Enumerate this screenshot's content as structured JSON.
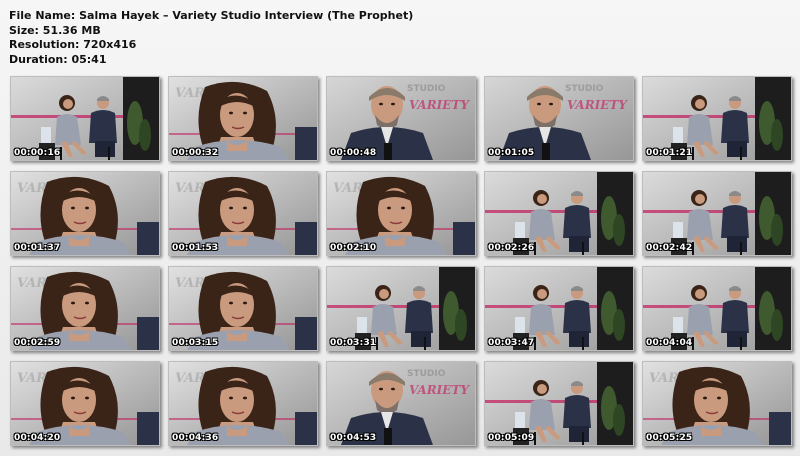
{
  "info": {
    "file_name": "File Name: Salma Hayek – Variety Studio Interview (The Prophet)",
    "size": "Size:  51.36 MB",
    "resolution": "Resolution: 720x416",
    "duration": "Duration:  05:41"
  },
  "thumbnails": [
    {
      "time": "00:00:16",
      "scene": "wide"
    },
    {
      "time": "00:00:32",
      "scene": "woman"
    },
    {
      "time": "00:00:48",
      "scene": "man"
    },
    {
      "time": "00:01:05",
      "scene": "man"
    },
    {
      "time": "00:01:21",
      "scene": "wide"
    },
    {
      "time": "00:01:37",
      "scene": "woman"
    },
    {
      "time": "00:01:53",
      "scene": "woman"
    },
    {
      "time": "00:02:10",
      "scene": "woman"
    },
    {
      "time": "00:02:26",
      "scene": "wide"
    },
    {
      "time": "00:02:42",
      "scene": "wide"
    },
    {
      "time": "00:02:59",
      "scene": "woman"
    },
    {
      "time": "00:03:15",
      "scene": "woman"
    },
    {
      "time": "00:03:31",
      "scene": "wide"
    },
    {
      "time": "00:03:47",
      "scene": "wide"
    },
    {
      "time": "00:04:04",
      "scene": "wide"
    },
    {
      "time": "00:04:20",
      "scene": "woman"
    },
    {
      "time": "00:04:36",
      "scene": "woman"
    },
    {
      "time": "00:04:53",
      "scene": "man"
    },
    {
      "time": "00:05:09",
      "scene": "wide"
    },
    {
      "time": "00:05:25",
      "scene": "woman"
    }
  ],
  "backdrop_text": {
    "variety": "VARIETY",
    "studio": "STUDIO"
  },
  "colors": {
    "backdrop": "#cfcfcf",
    "accent_magenta": "#c2185b",
    "suit": "#2b3247",
    "hair": "#3a2418",
    "skin": "#c99a7e",
    "dress": "#9aa0ad",
    "plant": "#3f5a2e"
  }
}
